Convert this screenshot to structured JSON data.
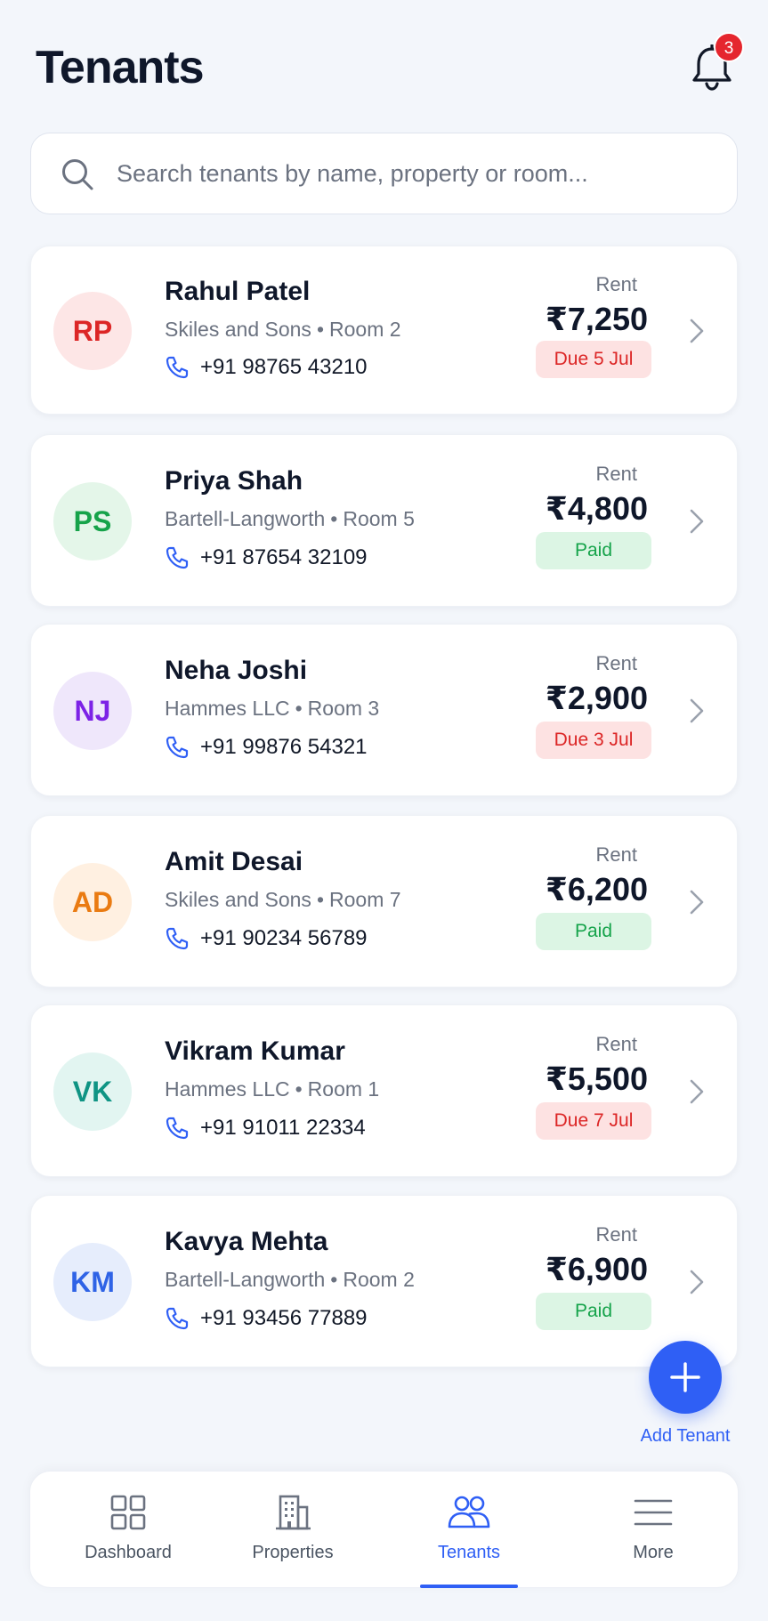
{
  "header": {
    "title": "Tenants",
    "notification_count": "3"
  },
  "search": {
    "placeholder": "Search tenants by name, property or room..."
  },
  "rent_label": "Rent",
  "tenants": [
    {
      "initials": "RP",
      "name": "Rahul Patel",
      "property": "Skiles and Sons",
      "room": "Room 2",
      "phone": "+91 98765 43210",
      "amount": "₹7,250",
      "status": "Due 5 Jul",
      "status_type": "due",
      "avatar_bg": "#fde6e6",
      "avatar_fg": "#dc2626"
    },
    {
      "initials": "PS",
      "name": "Priya Shah",
      "property": "Bartell-Langworth",
      "room": "Room 5",
      "phone": "+91 87654 32109",
      "amount": "₹4,800",
      "status": "Paid",
      "status_type": "paid",
      "avatar_bg": "#e4f6e9",
      "avatar_fg": "#16a34a"
    },
    {
      "initials": "NJ",
      "name": "Neha Joshi",
      "property": "Hammes LLC",
      "room": "Room 3",
      "phone": "+91 99876 54321",
      "amount": "₹2,900",
      "status": "Due 3 Jul",
      "status_type": "due",
      "avatar_bg": "#efe7fb",
      "avatar_fg": "#7c22e6"
    },
    {
      "initials": "AD",
      "name": "Amit Desai",
      "property": "Skiles and Sons",
      "room": "Room 7",
      "phone": "+91 90234 56789",
      "amount": "₹6,200",
      "status": "Paid",
      "status_type": "paid",
      "avatar_bg": "#fff0e1",
      "avatar_fg": "#ea7b12"
    },
    {
      "initials": "VK",
      "name": "Vikram Kumar",
      "property": "Hammes LLC",
      "room": "Room 1",
      "phone": "+91 91011 22334",
      "amount": "₹5,500",
      "status": "Due 7 Jul",
      "status_type": "due",
      "avatar_bg": "#e2f5f1",
      "avatar_fg": "#0f9484"
    },
    {
      "initials": "KM",
      "name": "Kavya Mehta",
      "property": "Bartell-Langworth",
      "room": "Room 2",
      "phone": "+91 93456 77889",
      "amount": "₹6,900",
      "status": "Paid",
      "status_type": "paid",
      "avatar_bg": "#e6edfc",
      "avatar_fg": "#2f63e6"
    }
  ],
  "fab": {
    "label": "Add Tenant"
  },
  "nav": {
    "items": [
      {
        "label": "Dashboard",
        "icon": "grid-icon"
      },
      {
        "label": "Properties",
        "icon": "building-icon"
      },
      {
        "label": "Tenants",
        "icon": "users-icon",
        "active": true
      },
      {
        "label": "More",
        "icon": "menu-icon"
      }
    ]
  },
  "colors": {
    "accent": "#2f5ff5",
    "due": "#dc2626",
    "paid": "#16a34a"
  }
}
